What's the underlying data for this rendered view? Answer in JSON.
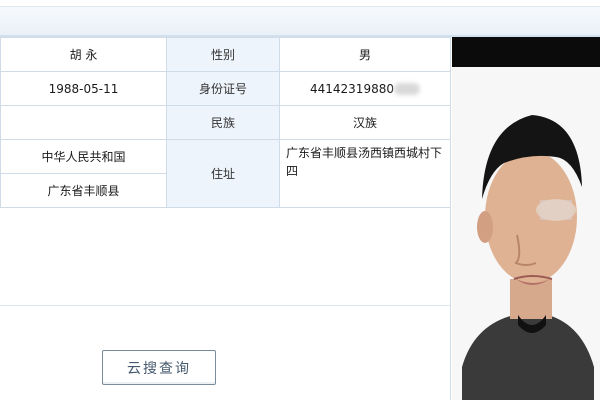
{
  "record": {
    "name": "胡 永",
    "birth_date": "1988-05-11",
    "nationality": "中华人民共和国",
    "birthplace": "广东省丰顺县",
    "gender_label": "性别",
    "gender_value": "男",
    "id_label": "身份证号",
    "id_value": "44142319880",
    "ethnicity_label": "民族",
    "ethnicity_value": "汉族",
    "address_label": "住址",
    "address_value": "广东省丰顺县汤西镇西城村下四"
  },
  "actions": {
    "search_button": "云搜查询"
  },
  "colors": {
    "grid_border": "#cfdbe7",
    "label_bg": "#eef4fb",
    "button_border": "#7a8c9c"
  }
}
